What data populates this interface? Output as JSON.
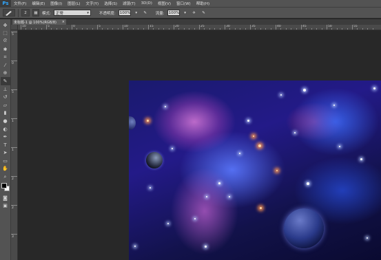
{
  "app": {
    "logo": "Ps",
    "menu": [
      "文件(F)",
      "编辑(E)",
      "图像(I)",
      "图层(L)",
      "文字(Y)",
      "选择(S)",
      "滤镜(T)",
      "3D(D)",
      "视图(V)",
      "窗口(W)",
      "帮助(H)"
    ]
  },
  "options": {
    "brush_size": "2",
    "mode_label": "模式:",
    "mode_value": "正常",
    "opacity_label": "不透明度:",
    "opacity_value": "100%",
    "flow_label": "流量:",
    "flow_value": "100%"
  },
  "document": {
    "tab_title": "未标题-1 @ 100%(RGB/8)",
    "tab_close": "×"
  },
  "ruler": {
    "top_labels": [
      "10",
      "5",
      "0",
      "5",
      "10",
      "15",
      "20",
      "25",
      "30",
      "35",
      "40",
      "45",
      "50",
      "55"
    ],
    "left_labels": [
      "5",
      "0",
      "5",
      "1",
      "1",
      "2",
      "2",
      "3"
    ]
  },
  "tools": [
    "move-icon",
    "marquee-icon",
    "lasso-icon",
    "quick-select-icon",
    "crop-icon",
    "eyedropper-icon",
    "healing-icon",
    "brush-icon",
    "stamp-icon",
    "history-brush-icon",
    "eraser-icon",
    "gradient-icon",
    "blur-icon",
    "dodge-icon",
    "pen-icon",
    "type-icon",
    "path-select-icon",
    "shape-icon",
    "hand-icon",
    "zoom-icon"
  ],
  "colors": {
    "foreground": "#000000",
    "background": "#ffffff"
  }
}
